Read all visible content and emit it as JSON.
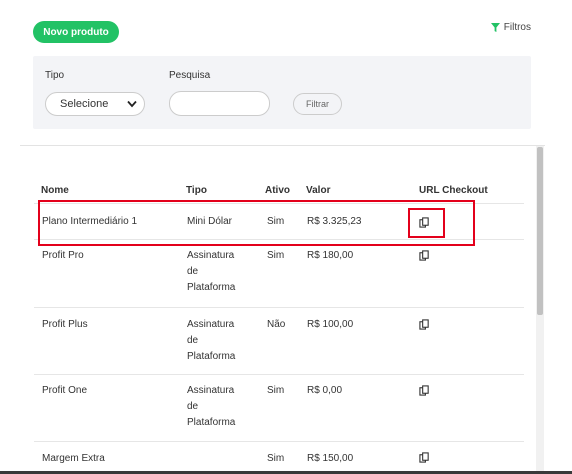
{
  "toolbar": {
    "new_product_label": "Novo produto",
    "filters_label": "Filtros"
  },
  "filters": {
    "type_label": "Tipo",
    "type_selected": "Selecione",
    "search_label": "Pesquisa",
    "search_value": "",
    "filter_button_label": "Filtrar"
  },
  "table": {
    "headers": {
      "nome": "Nome",
      "tipo": "Tipo",
      "ativo": "Ativo",
      "valor": "Valor",
      "url": "URL Checkout"
    },
    "rows": [
      {
        "nome": "Plano Intermediário 1",
        "tipo": "Mini Dólar",
        "ativo": "Sim",
        "valor": "R$ 3.325,23"
      },
      {
        "nome": "Profit Pro",
        "tipo": "Assinatura de Plataforma",
        "ativo": "Sim",
        "valor": "R$ 180,00"
      },
      {
        "nome": "Profit Plus",
        "tipo": "Assinatura de Plataforma",
        "ativo": "Não",
        "valor": "R$ 100,00"
      },
      {
        "nome": "Profit One",
        "tipo": "Assinatura de Plataforma",
        "ativo": "Sim",
        "valor": "R$ 0,00"
      },
      {
        "nome": "Margem Extra",
        "tipo": "",
        "ativo": "Sim",
        "valor": "R$ 150,00"
      }
    ]
  },
  "colors": {
    "accent": "#22c265",
    "highlight": "#e3001b",
    "filter_icon": "#22c265"
  },
  "icons": {
    "filter": "funnel-icon",
    "copy": "copy-icon",
    "select": "chevron-down-icon"
  }
}
